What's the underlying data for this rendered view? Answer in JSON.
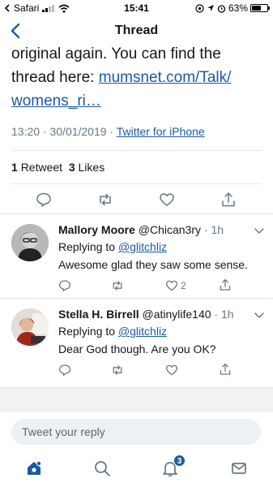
{
  "status": {
    "carrier": "Safari",
    "time": "15:41",
    "battery": "63%",
    "battery_level": 0.63
  },
  "nav": {
    "title": "Thread"
  },
  "tweet": {
    "line1": "original again. You can find the",
    "line2_prefix": "thread here: ",
    "link_part1": "mumsnet.com/Talk/",
    "link_part2": "womens_ri…",
    "timestamp": "13:20 · 30/01/2019 · ",
    "via": "Twitter for iPhone",
    "retweets_count": "1",
    "retweets_label": "Retweet",
    "likes_count": "3",
    "likes_label": "Likes"
  },
  "replies": [
    {
      "name": "Mallory Moore",
      "handle": "@Chican3ry",
      "time": " · 1h",
      "replying_prefix": "Replying to ",
      "replying_to": "@glitchliz",
      "body": "Awesome glad they saw some sense.",
      "like_count": "2"
    },
    {
      "name": "Stella H. Birrell",
      "handle": "@atinylife140",
      "time": " · 1h",
      "replying_prefix": "Replying to ",
      "replying_to": "@glitchliz",
      "body": "Dear God though. Are you OK?",
      "like_count": ""
    }
  ],
  "compose": {
    "placeholder": "Tweet your reply"
  },
  "tabbar": {
    "notifications_badge": "3"
  },
  "colors": {
    "link": "#1b5aa5",
    "muted": "#657786",
    "text": "#14171a"
  }
}
